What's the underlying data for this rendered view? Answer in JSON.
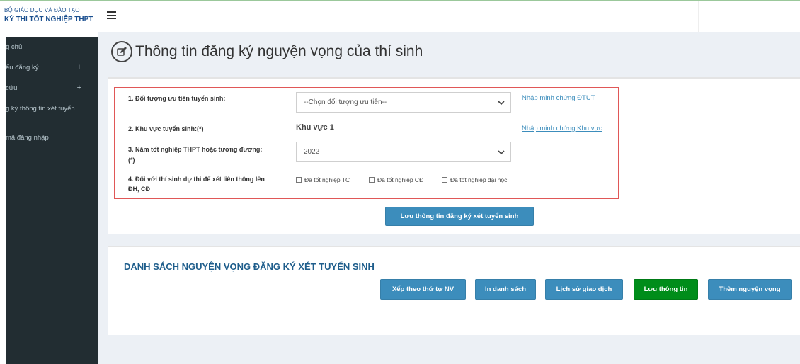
{
  "brand": {
    "line1": "BỘ GIÁO DỤC VÀ ĐÀO TẠO",
    "line2": "KỲ THI TỐT NGHIỆP THPT"
  },
  "sidebar": {
    "items": [
      {
        "label": "g chủ",
        "plus": ""
      },
      {
        "label": "ếu đăng ký",
        "plus": "+"
      },
      {
        "label": "cứu",
        "plus": "+"
      },
      {
        "label": "g ký thông tin xét tuyển",
        "plus": ""
      },
      {
        "label": "mã đăng nhập",
        "plus": ""
      }
    ]
  },
  "page": {
    "title": "Thông tin đăng ký nguyện vọng của thí sinh"
  },
  "form": {
    "priority_label": "1. Đối tượng ưu tiên tuyển sinh:",
    "priority_select": "--Chọn đối tượng ưu tiên--",
    "priority_link": "Nhập minh chứng ĐTUT",
    "region_label": "2. Khu vực tuyển sinh:(*)",
    "region_value": "Khu vực 1",
    "region_link": "Nhập minh chứng Khu vực",
    "grad_year_label_1": "3. Năm tốt nghiệp THPT hoặc tương đương:",
    "grad_year_label_2": "(*)",
    "grad_year_select": "2022",
    "transfer_label_1": "4. Đối với thí sinh dự thi để xét liên thông lên",
    "transfer_label_2": "ĐH, CĐ",
    "checkboxes": [
      "Đã tốt nghiệp TC",
      "Đã tốt nghiệp CĐ",
      "Đã tốt nghiệp đại học"
    ],
    "save_button": "Lưu thông tin đăng ký xét tuyển sinh"
  },
  "wishlist": {
    "title": "DANH SÁCH NGUYỆN VỌNG ĐĂNG KÝ XÉT TUYỂN SINH",
    "buttons": {
      "sort": "Xếp theo thứ tự NV",
      "print": "In danh sách",
      "history": "Lịch sử giao dịch",
      "save": "Lưu thông tin",
      "add": "Thêm nguyện vọng"
    }
  },
  "colors": {
    "sidebar_bg": "#222d32",
    "content_bg": "#ecf0f5",
    "primary": "#3c8dbc",
    "success": "#008d1a",
    "highlight_border": "#e05757"
  }
}
